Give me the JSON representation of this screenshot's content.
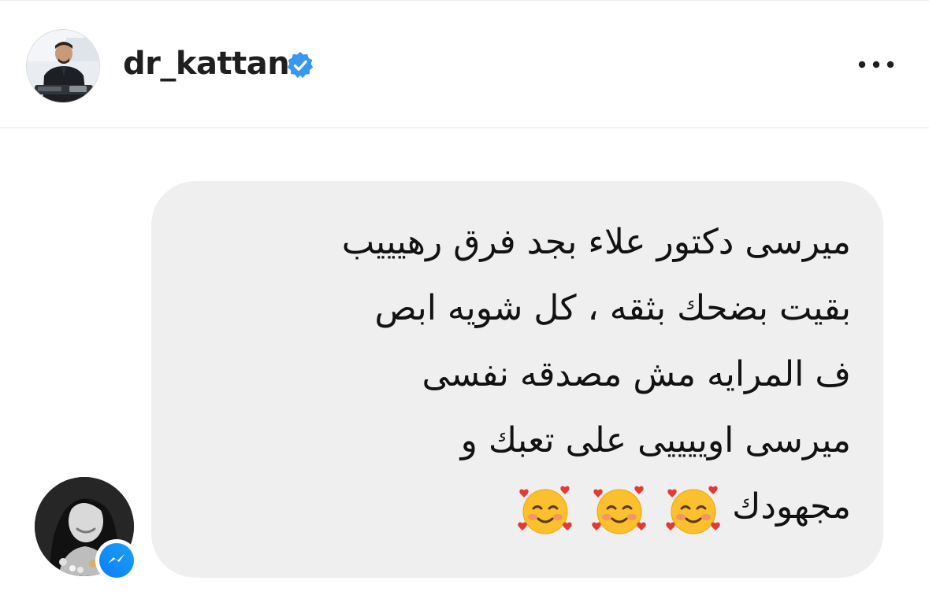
{
  "header": {
    "username": "dr_kattan",
    "verified": true,
    "icons": {
      "avatar": "profile-photo",
      "verified": "verified-badge-icon",
      "more": "more-options-icon"
    }
  },
  "message": {
    "lines": [
      "ميرسى دكتور علاء بجد فرق رهيييب",
      "بقيت بضحك بثقه ، كل شويه ابص",
      "ف المرايه مش مصدقه نفسى",
      "ميرسى اوييييى على تعبك و",
      "مجهودك"
    ],
    "emojis": [
      "🥰",
      "🥰",
      "🥰"
    ],
    "sender_badge": "messenger-icon"
  },
  "colors": {
    "bubble": "#efefef",
    "verified": "#3897f0",
    "messenger_gradient_start": "#0a7cff",
    "messenger_gradient_end": "#1da1f2"
  }
}
